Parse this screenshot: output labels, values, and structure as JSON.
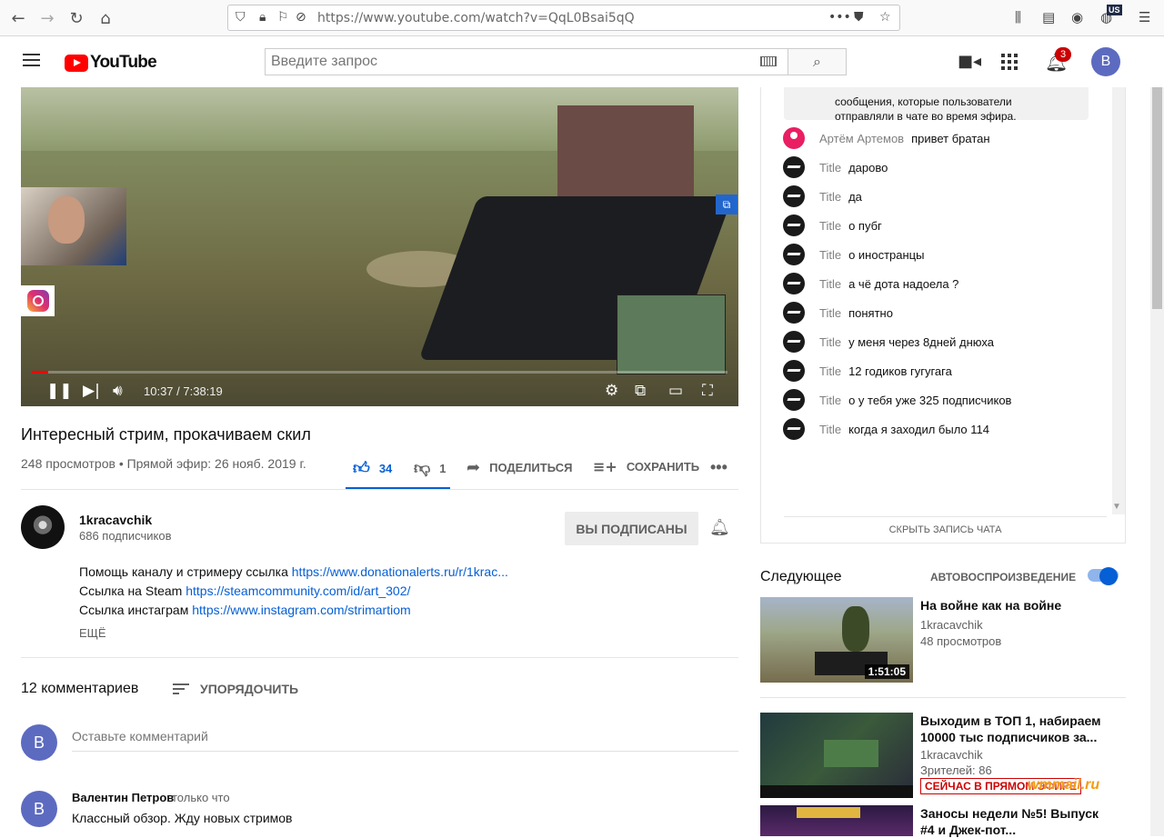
{
  "browser": {
    "url": "https://www.youtube.com/watch?v=QqL0Bsai5qQ",
    "locale_badge": "US"
  },
  "header": {
    "logo_text": "YouTube",
    "search_placeholder": "Введите запрос",
    "notifications_count": "3",
    "avatar_letter": "B"
  },
  "player": {
    "time": "10:37 / 7:38:19",
    "progress": 0.023
  },
  "video": {
    "title": "Интересный стрим, прокачиваем скил",
    "meta": "248 просмотров • Прямой эфир: 26 нояб. 2019 г.",
    "likes": "34",
    "dislikes": "1",
    "share_label": "ПОДЕЛИТЬСЯ",
    "save_label": "СОХРАНИТЬ"
  },
  "channel": {
    "name": "1kracavchik",
    "subscribers": "686 подписчиков",
    "subscribed_label": "ВЫ ПОДПИСАНЫ"
  },
  "description": {
    "lines": [
      {
        "text": "Помощь каналу и стримеру ссылка ",
        "link": "https://www.donationalerts.ru/r/1krac..."
      },
      {
        "text": "Ссылка на Steam ",
        "link": "https://steamcommunity.com/id/art_302/"
      },
      {
        "text": "Ссылка инстаграм ",
        "link": "https://www.instagram.com/strimartiom"
      }
    ],
    "more_label": "ЕЩЁ"
  },
  "comments": {
    "count_label": "12 комментариев",
    "sort_label": "УПОРЯДОЧИТЬ",
    "input_placeholder": "Оставьте комментарий",
    "user_letter": "B",
    "items": [
      {
        "author": "Валентин Петров",
        "time": "только что",
        "text": "Классный обзор. Жду новых стримов",
        "letter": "B"
      }
    ]
  },
  "chat": {
    "notice": "сообщения, которые пользователи\nотправляли в чате во время эфира.",
    "messages": [
      {
        "author": "Артём Артемов",
        "text": "привет братан"
      },
      {
        "author": "Title",
        "text": "дарово"
      },
      {
        "author": "Title",
        "text": "да"
      },
      {
        "author": "Title",
        "text": "о пубг"
      },
      {
        "author": "Title",
        "text": "о иностранцы"
      },
      {
        "author": "Title",
        "text": "а чё дота надоела ?"
      },
      {
        "author": "Title",
        "text": "понятно"
      },
      {
        "author": "Title",
        "text": "у меня через 8дней днюха"
      },
      {
        "author": "Title",
        "text": "12 годиков гугугага"
      },
      {
        "author": "Title",
        "text": "о у тебя уже 325 подписчиков"
      },
      {
        "author": "Title",
        "text": "когда я заходил было 114"
      }
    ],
    "hide_label": "СКРЫТЬ ЗАПИСЬ ЧАТА"
  },
  "upnext": {
    "label": "Следующее",
    "autoplay_label": "АВТОВОСПРОИЗВЕДЕНИЕ",
    "autoplay_on": true,
    "items": [
      {
        "title": "На войне как на войне",
        "channel": "1kracavchik",
        "views": "48 просмотров",
        "duration": "1:51:05"
      },
      {
        "title": "Выходим в ТОП 1, набираем 10000 тыс подписчиков за...",
        "channel": "1kracavchik",
        "views": "Зрителей: 86",
        "live": "СЕЙЧАС В ПРЯМОМ ЭФИРЕ"
      },
      {
        "title": "Заносы недели №5! Выпуск #4 и Джек-пот..."
      }
    ]
  },
  "watermark": "wmmail.ru",
  "colors": {
    "accent": "#065fd4",
    "brand": "#ff0000",
    "live": "#cc0000"
  }
}
